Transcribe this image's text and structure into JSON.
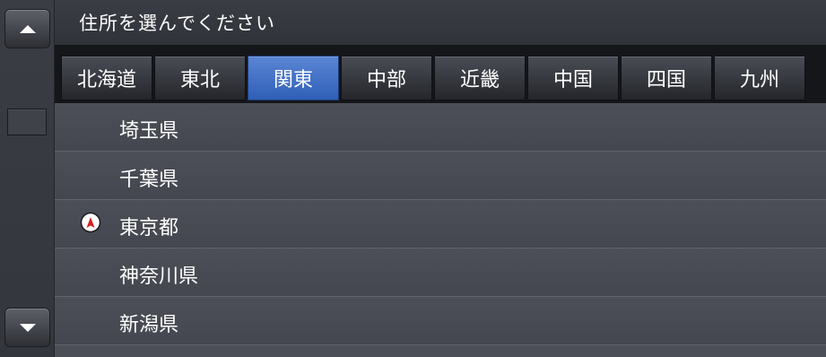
{
  "header": {
    "title": "住所を選んでください"
  },
  "tabs": [
    {
      "label": "北海道",
      "active": false
    },
    {
      "label": "東北",
      "active": false
    },
    {
      "label": "関東",
      "active": true
    },
    {
      "label": "中部",
      "active": false
    },
    {
      "label": "近畿",
      "active": false
    },
    {
      "label": "中国",
      "active": false
    },
    {
      "label": "四国",
      "active": false
    },
    {
      "label": "九州",
      "active": false
    }
  ],
  "list": {
    "items": [
      {
        "label": "埼玉県",
        "icon": ""
      },
      {
        "label": "千葉県",
        "icon": ""
      },
      {
        "label": "東京都",
        "icon": "current-location-icon"
      },
      {
        "label": "神奈川県",
        "icon": ""
      },
      {
        "label": "新潟県",
        "icon": ""
      }
    ]
  },
  "scroll": {
    "up_icon": "arrow-up-icon",
    "down_icon": "arrow-down-icon"
  },
  "colors": {
    "active_tab": "#3e6fc6",
    "background": "#3b3e45",
    "marker": "#d32020"
  }
}
